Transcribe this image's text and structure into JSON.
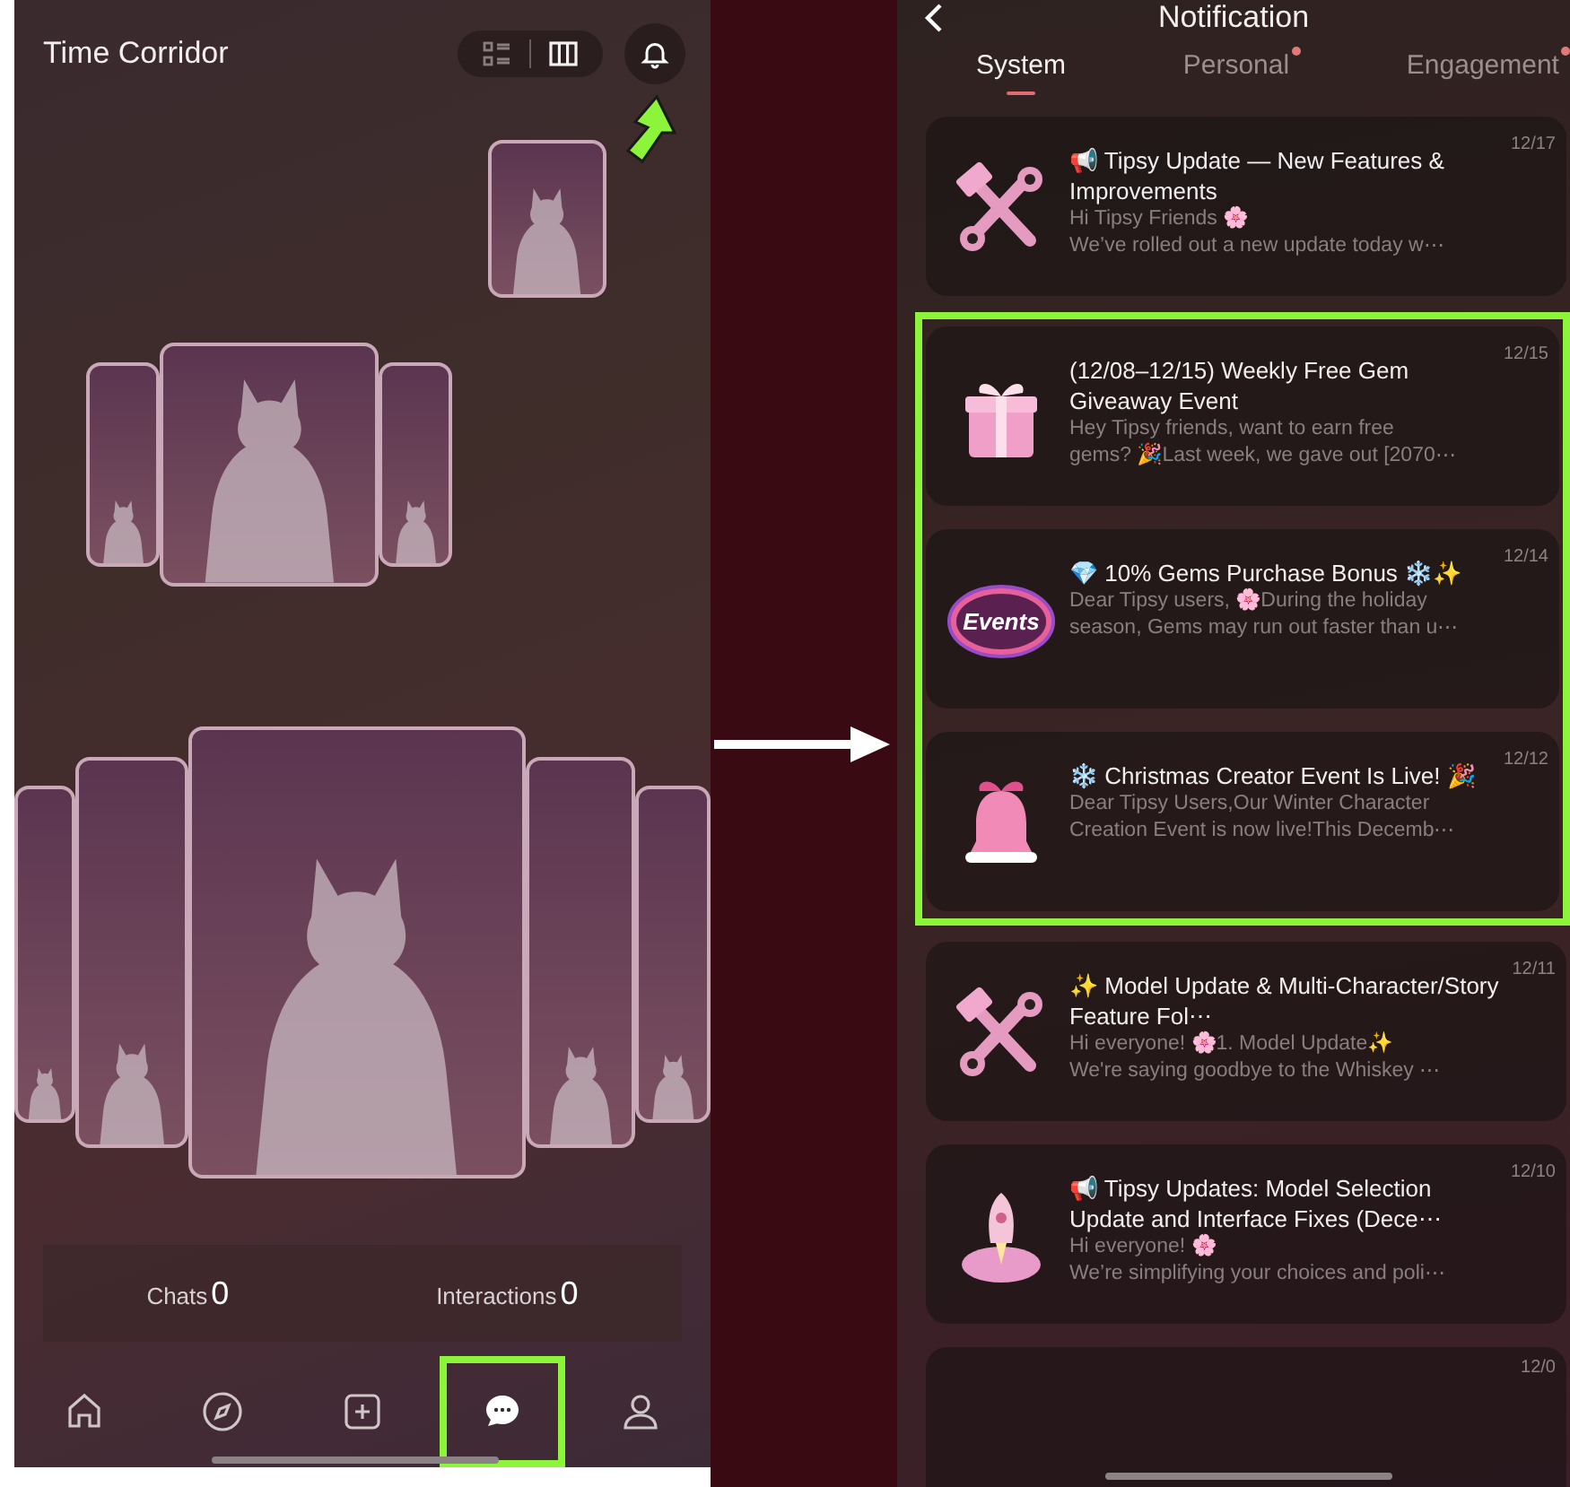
{
  "home": {
    "title": "Time Corridor",
    "view_toggle": [
      {
        "kind": "list",
        "selected": false
      },
      {
        "kind": "columns",
        "selected": true
      }
    ],
    "stats": [
      {
        "label": "Chats",
        "value": "0"
      },
      {
        "label": "Interactions",
        "value": "0"
      }
    ],
    "nav": [
      {
        "kind": "home",
        "selected": false
      },
      {
        "kind": "compass",
        "selected": false
      },
      {
        "kind": "plus",
        "selected": false
      },
      {
        "kind": "chat",
        "selected": true
      },
      {
        "kind": "profile",
        "selected": false
      }
    ]
  },
  "notification": {
    "title": "Notification",
    "tabs": [
      {
        "label": "System",
        "selected": true,
        "dot": false
      },
      {
        "label": "Personal",
        "selected": false,
        "dot": true
      },
      {
        "label": "Engagement",
        "selected": false,
        "dot": true
      }
    ],
    "items": [
      {
        "kind": "tools",
        "title": "📢 Tipsy Update — New Features & Improvements",
        "preview": [
          "Hi Tipsy Friends 🌸",
          "We’ve rolled out a new update today w⋯"
        ],
        "date": "12/17",
        "highlighted": false
      },
      {
        "kind": "gift",
        "title": "(12/08–12/15) Weekly Free Gem Giveaway Event",
        "preview": [
          "Hey Tipsy friends, want to earn free",
          "gems? 🎉Last week, we gave out [2070⋯"
        ],
        "date": "12/15",
        "highlighted": true
      },
      {
        "kind": "events",
        "sticker": "Events",
        "title": "💎 10% Gems Purchase Bonus ❄️✨",
        "preview": [
          "Dear Tipsy users, 🌸During the holiday",
          "season, Gems may run out faster than u⋯"
        ],
        "date": "12/14",
        "highlighted": true
      },
      {
        "kind": "bell",
        "title": "❄️ Christmas Creator Event Is Live! 🎉",
        "preview": [
          "Dear Tipsy Users,Our Winter Character",
          "Creation Event is now live!This Decemb⋯"
        ],
        "date": "12/12",
        "highlighted": true
      },
      {
        "kind": "tools",
        "title": "✨ Model Update & Multi-Character/Story Feature Fol⋯",
        "preview": [
          "Hi everyone! 🌸1. Model Update✨",
          "We're saying goodbye to the Whiskey ⋯"
        ],
        "date": "12/11",
        "highlighted": false
      },
      {
        "kind": "rocket",
        "title": "📢 Tipsy Updates: Model Selection Update and Interface Fixes (Dece⋯",
        "preview": [
          "Hi everyone! 🌸",
          "We’re simplifying your choices and poli⋯"
        ],
        "date": "12/10",
        "highlighted": false
      },
      {
        "kind": "partial",
        "date": "12/0",
        "highlighted": false
      }
    ]
  }
}
